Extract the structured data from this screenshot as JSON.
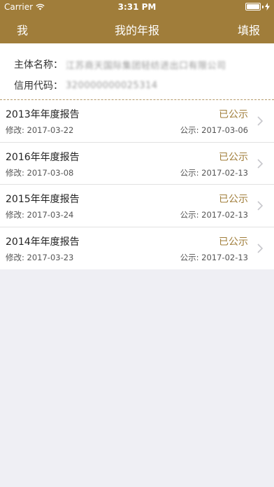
{
  "status_bar": {
    "carrier": "Carrier",
    "time": "3:31 PM",
    "battery_level": 1.0
  },
  "nav": {
    "left": "我",
    "title": "我的年报",
    "right": "填报"
  },
  "info": {
    "entity_label": "主体名称：",
    "entity_value": "江苏商天国际集团轻纺进出口有限公司",
    "credit_label": "信用代码：",
    "credit_value": "320000000025314"
  },
  "reports": [
    {
      "title": "2013年年度报告",
      "status": "已公示",
      "modified": "修改: 2017-03-22",
      "published": "公示: 2017-03-06"
    },
    {
      "title": "2016年年度报告",
      "status": "已公示",
      "modified": "修改: 2017-03-08",
      "published": "公示: 2017-02-13"
    },
    {
      "title": "2015年年度报告",
      "status": "已公示",
      "modified": "修改: 2017-03-24",
      "published": "公示: 2017-02-13"
    },
    {
      "title": "2014年年度报告",
      "status": "已公示",
      "modified": "修改: 2017-03-23",
      "published": "公示: 2017-02-13"
    }
  ],
  "icons": {
    "wifi": "wifi-icon",
    "battery": "battery-icon",
    "charging": "charging-bolt-icon",
    "chevron": "chevron-right-icon"
  },
  "colors": {
    "brand": "#a07d3a",
    "background": "#efeff4"
  }
}
